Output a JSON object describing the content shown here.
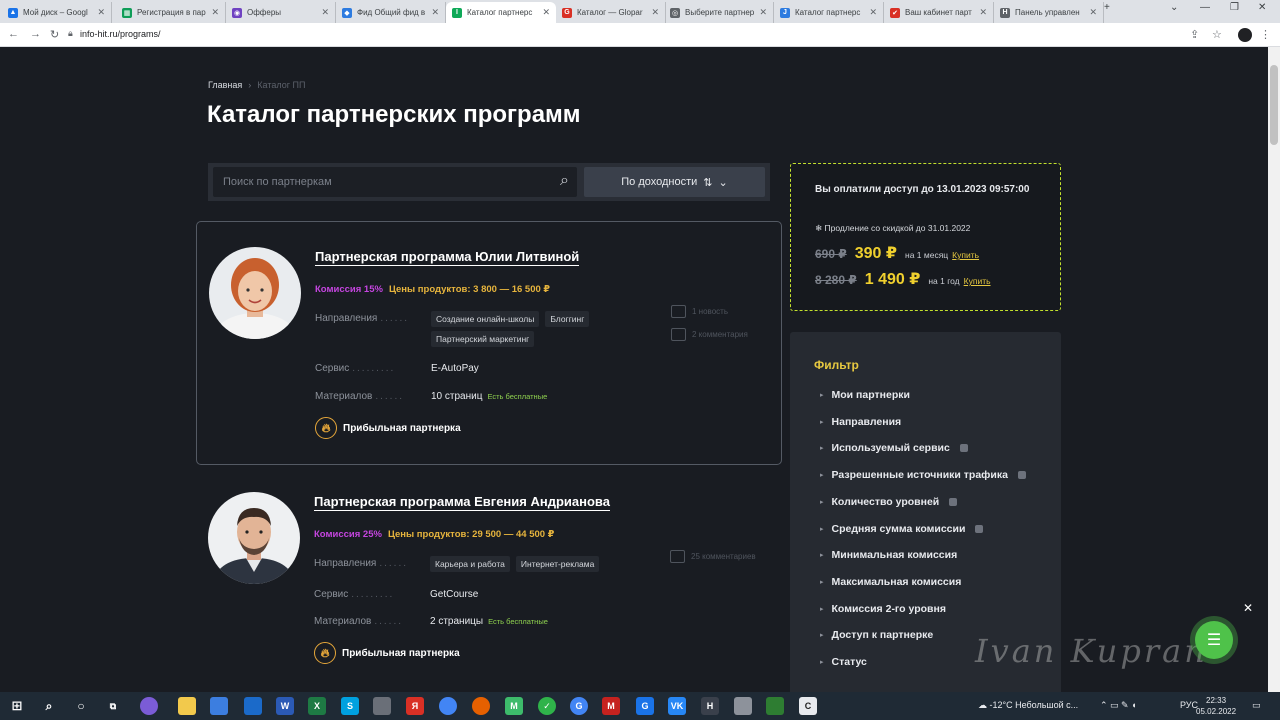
{
  "browser": {
    "tabs": [
      {
        "title": "Мой диск – Googl",
        "color": "#1a73e8",
        "glyph": "▲"
      },
      {
        "title": "Регистрация в пар",
        "color": "#0f9d58",
        "glyph": "▦"
      },
      {
        "title": "Офферы",
        "color": "#6f42c1",
        "glyph": "◉"
      },
      {
        "title": "Фид Общий фид в",
        "color": "#2d7be0",
        "glyph": "◆"
      },
      {
        "title": "Каталог партнерс",
        "color": "#0fa958",
        "glyph": "I"
      },
      {
        "title": "Каталог — Glopar",
        "color": "#d93025",
        "glyph": "G"
      },
      {
        "title": "Выберите партнер",
        "color": "#5f6368",
        "glyph": "◎"
      },
      {
        "title": "Каталог партнерс",
        "color": "#2d7be0",
        "glyph": "J"
      },
      {
        "title": "Ваш кабинет парт",
        "color": "#d93025",
        "glyph": "✔"
      },
      {
        "title": "Панель управлен",
        "color": "#5f6368",
        "glyph": "H"
      }
    ],
    "new_tab": "+",
    "url": "info-hit.ru/programs/"
  },
  "breadcrumbs": {
    "home": "Главная",
    "separator": "›",
    "current": "Каталог ПП"
  },
  "page_title": "Каталог партнерских программ",
  "search": {
    "placeholder": "Поиск по партнеркам"
  },
  "sort": {
    "label": "По доходности"
  },
  "programs": [
    {
      "title": "Партнерская программа Юлии Литвиной",
      "commission": "Комиссия 15%",
      "prices": "Цены продуктов: 3 800 — 16 500 ₽",
      "directions_label": "Направления",
      "tags": [
        "Создание онлайн-школы",
        "Блоггинг",
        "Партнерский маркетинг"
      ],
      "service_label": "Сервис",
      "service": "E-AutoPay",
      "materials_label": "Материалов",
      "materials": "10 страниц",
      "free": "Есть бесплатные",
      "badge": "Прибыльная партнерка",
      "news": "1 новость",
      "comments": "2 комментария"
    },
    {
      "title": "Партнерская программа Евгения Андрианова",
      "commission": "Комиссия 25%",
      "prices": "Цены продуктов: 29 500 — 44 500 ₽",
      "directions_label": "Направления",
      "tags": [
        "Карьера и работа",
        "Интернет-реклама"
      ],
      "service_label": "Сервис",
      "service": "GetCourse",
      "materials_label": "Материалов",
      "materials": "2 страницы",
      "free": "Есть бесплатные",
      "badge": "Прибыльная партнерка",
      "comments": "25 комментариев"
    }
  ],
  "subscription": {
    "paid_until": "Вы оплатили доступ до 13.01.2023 09:57:00",
    "discount": "❄ Продление со скидкой до 31.01.2022",
    "plans": [
      {
        "old": "690 ₽",
        "new": "390 ₽",
        "period": "на 1 месяц",
        "buy": "Купить"
      },
      {
        "old": "8 280 ₽",
        "new": "1 490 ₽",
        "period": "на 1 год",
        "buy": "Купить"
      }
    ]
  },
  "filter": {
    "title": "Фильтр",
    "items": [
      {
        "label": "Мои партнерки",
        "info": false
      },
      {
        "label": "Направления",
        "info": false
      },
      {
        "label": "Используемый сервис",
        "info": true
      },
      {
        "label": "Разрешенные источники трафика",
        "info": true
      },
      {
        "label": "Количество уровней",
        "info": true
      },
      {
        "label": "Средняя сумма комиссии",
        "info": true
      },
      {
        "label": "Минимальная комиссия",
        "info": false
      },
      {
        "label": "Максимальная комиссия",
        "info": false
      },
      {
        "label": "Комиссия 2-го уровня",
        "info": false
      },
      {
        "label": "Доступ к партнерке",
        "info": false
      },
      {
        "label": "Статус",
        "info": false
      }
    ]
  },
  "watermark": "Ivan Kupran",
  "taskbar": {
    "weather": "-12°C  Небольшой с...",
    "lang": "РУС",
    "time": "22:33",
    "date": "05.02.2022"
  }
}
